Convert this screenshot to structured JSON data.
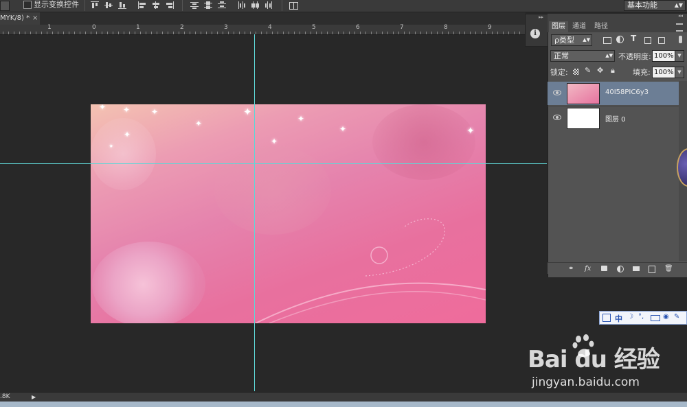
{
  "options_bar": {
    "show_transform_controls_label": "显示变换控件",
    "workspace_label": "基本功能"
  },
  "document": {
    "tab_title": "MYK/8) *",
    "tab_close": "×"
  },
  "ruler": {
    "labels": [
      "1",
      "0",
      "1",
      "2",
      "3",
      "4",
      "5",
      "6",
      "7",
      "8",
      "9"
    ]
  },
  "layers_panel": {
    "tabs": [
      "图层",
      "通道",
      "路径"
    ],
    "filter_label": "ρ类型",
    "blend_mode": "正常",
    "opacity_label": "不透明度:",
    "opacity_value": "100%",
    "lock_label": "锁定:",
    "fill_label": "填充:",
    "fill_value": "100%",
    "layers": [
      {
        "name": "40I58PIC6y3",
        "selected": true
      },
      {
        "name": "图层 0",
        "selected": false
      }
    ]
  },
  "status_bar": {
    "size_text": ".8K"
  },
  "watermark": {
    "brand": "Bai du 经验",
    "url": "jingyan.baidu.com"
  },
  "colors": {
    "guide": "#5fd6d6",
    "selected_layer": "#6c7e95",
    "panel_bg": "#535353",
    "workspace_bg": "#282828"
  }
}
